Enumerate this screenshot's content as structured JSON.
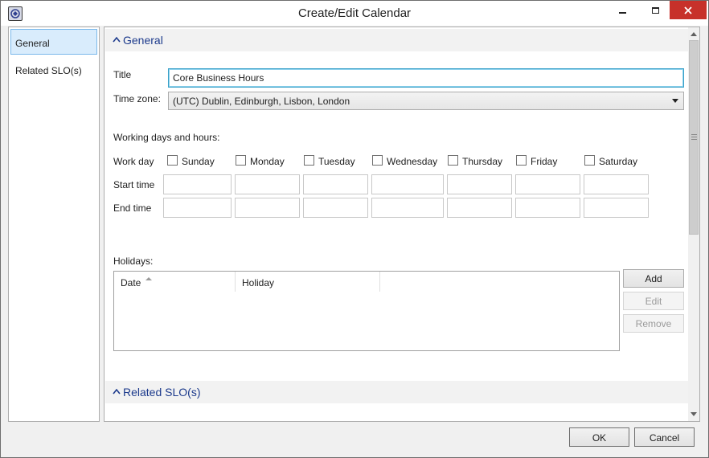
{
  "window": {
    "title": "Create/Edit Calendar",
    "close_color": "#c7312a"
  },
  "nav": {
    "items": [
      {
        "label": "General",
        "selected": true
      },
      {
        "label": "Related SLO(s)",
        "selected": false
      }
    ]
  },
  "general": {
    "header": "General",
    "title_label": "Title",
    "title_value": "Core Business Hours",
    "timezone_label": "Time zone:",
    "timezone_value": "(UTC) Dublin, Edinburgh, Lisbon, London",
    "working_label": "Working days and hours:",
    "work_day_label": "Work day",
    "start_time_label": "Start time",
    "end_time_label": "End time",
    "days": [
      {
        "label": "Sunday",
        "checked": false
      },
      {
        "label": "Monday",
        "checked": false
      },
      {
        "label": "Tuesday",
        "checked": false
      },
      {
        "label": "Wednesday",
        "checked": false
      },
      {
        "label": "Thursday",
        "checked": false
      },
      {
        "label": "Friday",
        "checked": false
      },
      {
        "label": "Saturday",
        "checked": false
      }
    ],
    "holidays_label": "Holidays:",
    "holidays_columns": [
      "Date",
      "Holiday"
    ],
    "holidays_rows": [],
    "add_label": "Add",
    "edit_label": "Edit",
    "remove_label": "Remove"
  },
  "related": {
    "header": "Related SLO(s)"
  },
  "footer": {
    "ok_label": "OK",
    "cancel_label": "Cancel"
  },
  "colors": {
    "accent_header_text": "#1c3a8c",
    "selection_bg": "#d9ecfc",
    "selection_border": "#7ab8ea"
  }
}
